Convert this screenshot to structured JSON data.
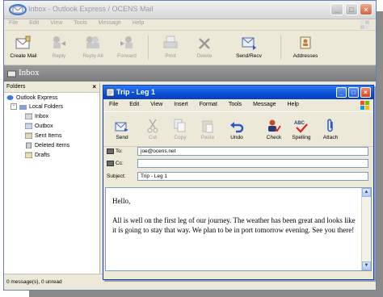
{
  "main_window": {
    "title": "Inbox - Outlook Express / OCENS Mail",
    "menu": [
      "File",
      "Edit",
      "View",
      "Tools",
      "Message",
      "Help"
    ],
    "toolbar": [
      {
        "label": "Create Mail",
        "icon": "create-mail-icon"
      },
      {
        "label": "Reply",
        "icon": "reply-icon"
      },
      {
        "label": "Reply All",
        "icon": "reply-all-icon"
      },
      {
        "label": "Forward",
        "icon": "forward-icon"
      },
      {
        "label": "Print",
        "icon": "print-icon"
      },
      {
        "label": "Delete",
        "icon": "delete-icon"
      },
      {
        "label": "Send/Recv",
        "icon": "send-receive-icon"
      },
      {
        "label": "Addresses",
        "icon": "addresses-icon"
      }
    ],
    "infobar": "Inbox",
    "folders": {
      "header": "Folders",
      "items": [
        "Outlook Express",
        "Local Folders",
        "Inbox",
        "Outbox",
        "Sent Items",
        "Deleted Items",
        "Drafts"
      ]
    },
    "status": "0 message(s), 0 unread"
  },
  "compose": {
    "title": "Trip - Leg 1",
    "menu": [
      "File",
      "Edit",
      "View",
      "Insert",
      "Format",
      "Tools",
      "Message",
      "Help"
    ],
    "toolbar": [
      {
        "label": "Send",
        "icon": "send-icon"
      },
      {
        "label": "Cut",
        "icon": "cut-icon"
      },
      {
        "label": "Copy",
        "icon": "copy-icon"
      },
      {
        "label": "Paste",
        "icon": "paste-icon"
      },
      {
        "label": "Undo",
        "icon": "undo-icon"
      },
      {
        "label": "Check",
        "icon": "check-names-icon"
      },
      {
        "label": "Spelling",
        "icon": "spelling-icon"
      },
      {
        "label": "Attach",
        "icon": "attach-icon"
      }
    ],
    "to_label": "To:",
    "to_value": "joe@ocens.net",
    "cc_label": "Cc:",
    "cc_value": "",
    "subject_label": "Subject:",
    "subject_value": "Trip - Leg 1",
    "body": {
      "greeting": "Hello,",
      "paragraph": "All is well on the first leg of our journey. The weather has been great and looks like it is going to stay that way. We plan to be in port tomorrow evening. See you there!"
    }
  },
  "colors": {
    "compose_titlebar": "#0a4fd6",
    "close_red": "#d8613e",
    "infobar": "#8a8a8a"
  }
}
